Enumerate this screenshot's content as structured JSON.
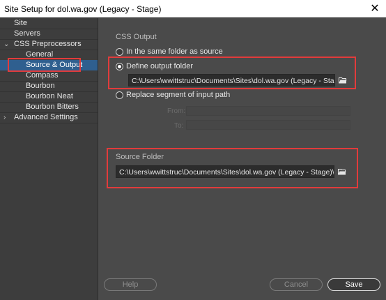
{
  "window": {
    "title": "Site Setup for dol.wa.gov (Legacy - Stage)",
    "close_glyph": "✕"
  },
  "sidebar": {
    "items": [
      {
        "label": "Site"
      },
      {
        "label": "Servers"
      },
      {
        "label": "CSS Preprocessors"
      },
      {
        "label": "General"
      },
      {
        "label": "Source & Output"
      },
      {
        "label": "Compass"
      },
      {
        "label": "Bourbon"
      },
      {
        "label": "Bourbon Neat"
      },
      {
        "label": "Bourbon Bitters"
      },
      {
        "label": "Advanced Settings"
      }
    ],
    "selected": "Source & Output"
  },
  "css_output": {
    "label": "CSS Output",
    "options": [
      {
        "label": "In the same folder as source",
        "selected": false
      },
      {
        "label": "Define output folder",
        "selected": true
      },
      {
        "label": "Replace segment of input path",
        "selected": false
      }
    ],
    "output_path": "C:\\Users\\wwittstruc\\Documents\\Sites\\dol.wa.gov (Legacy - Stage)\\css\\",
    "from_label": "From:",
    "to_label": "To:"
  },
  "source_folder": {
    "label": "Source Folder",
    "path": "C:\\Users\\wwittstruc\\Documents\\Sites\\dol.wa.gov (Legacy - Stage)\\css\\sass\\"
  },
  "buttons": {
    "help": "Help",
    "cancel": "Cancel",
    "save": "Save"
  },
  "colors": {
    "highlight": "#e23b3b",
    "selection": "#2f5f8f",
    "background": "#4a4a4a",
    "sidebar": "#3d3d3d"
  },
  "icons": {
    "folder": "folder-open-icon",
    "collapse": "chevron-down-icon",
    "expand": "chevron-right-icon"
  }
}
